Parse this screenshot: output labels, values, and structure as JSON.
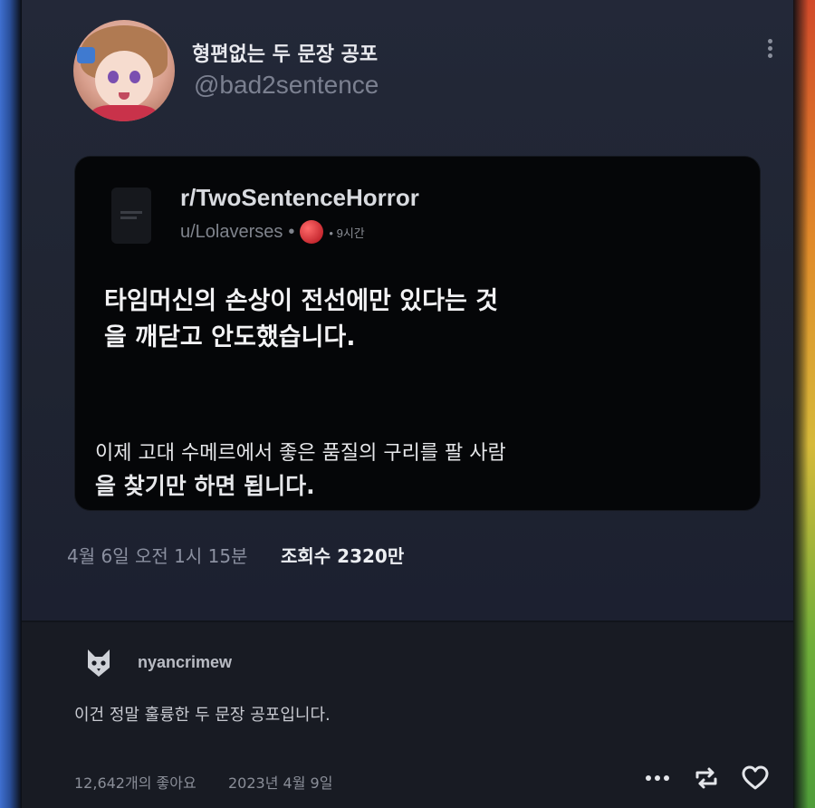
{
  "tweet": {
    "display_name": "형편없는 두 문장 공포",
    "handle": "@bad2sentence",
    "timestamp": "4월 6일 오전 1시 15분",
    "views": "조회수 2320만"
  },
  "quote": {
    "subreddit": "r/TwoSentenceHorror",
    "user": "u/Lolaverses",
    "separator": "•",
    "time": "• 9시간",
    "line1a": "타임머신의 손상이 전선에만 있다는 것",
    "line1b": "을 깨닫고 안도했습니다.",
    "line2a": "이제 고대 수메르에서 좋은 품질의 구리를 팔 사람",
    "line2b": "을 찾기만 하면 됩니다."
  },
  "tumblr": {
    "username": "nyancrimew",
    "comment": "이건 정말 훌륭한 두 문장 공포입니다.",
    "likes": "12,642개의 좋아요",
    "date": "2023년 4월 9일"
  },
  "colors": {
    "background": "#202533",
    "quote_card": "#050608",
    "tumblr_bg": "#181b23",
    "muted_text": "#8b90a0"
  },
  "icons": [
    "more-vertical-icon",
    "reddit-badge-icon",
    "cat-avatar-icon",
    "more-horizontal-icon",
    "reblog-icon",
    "heart-icon"
  ]
}
